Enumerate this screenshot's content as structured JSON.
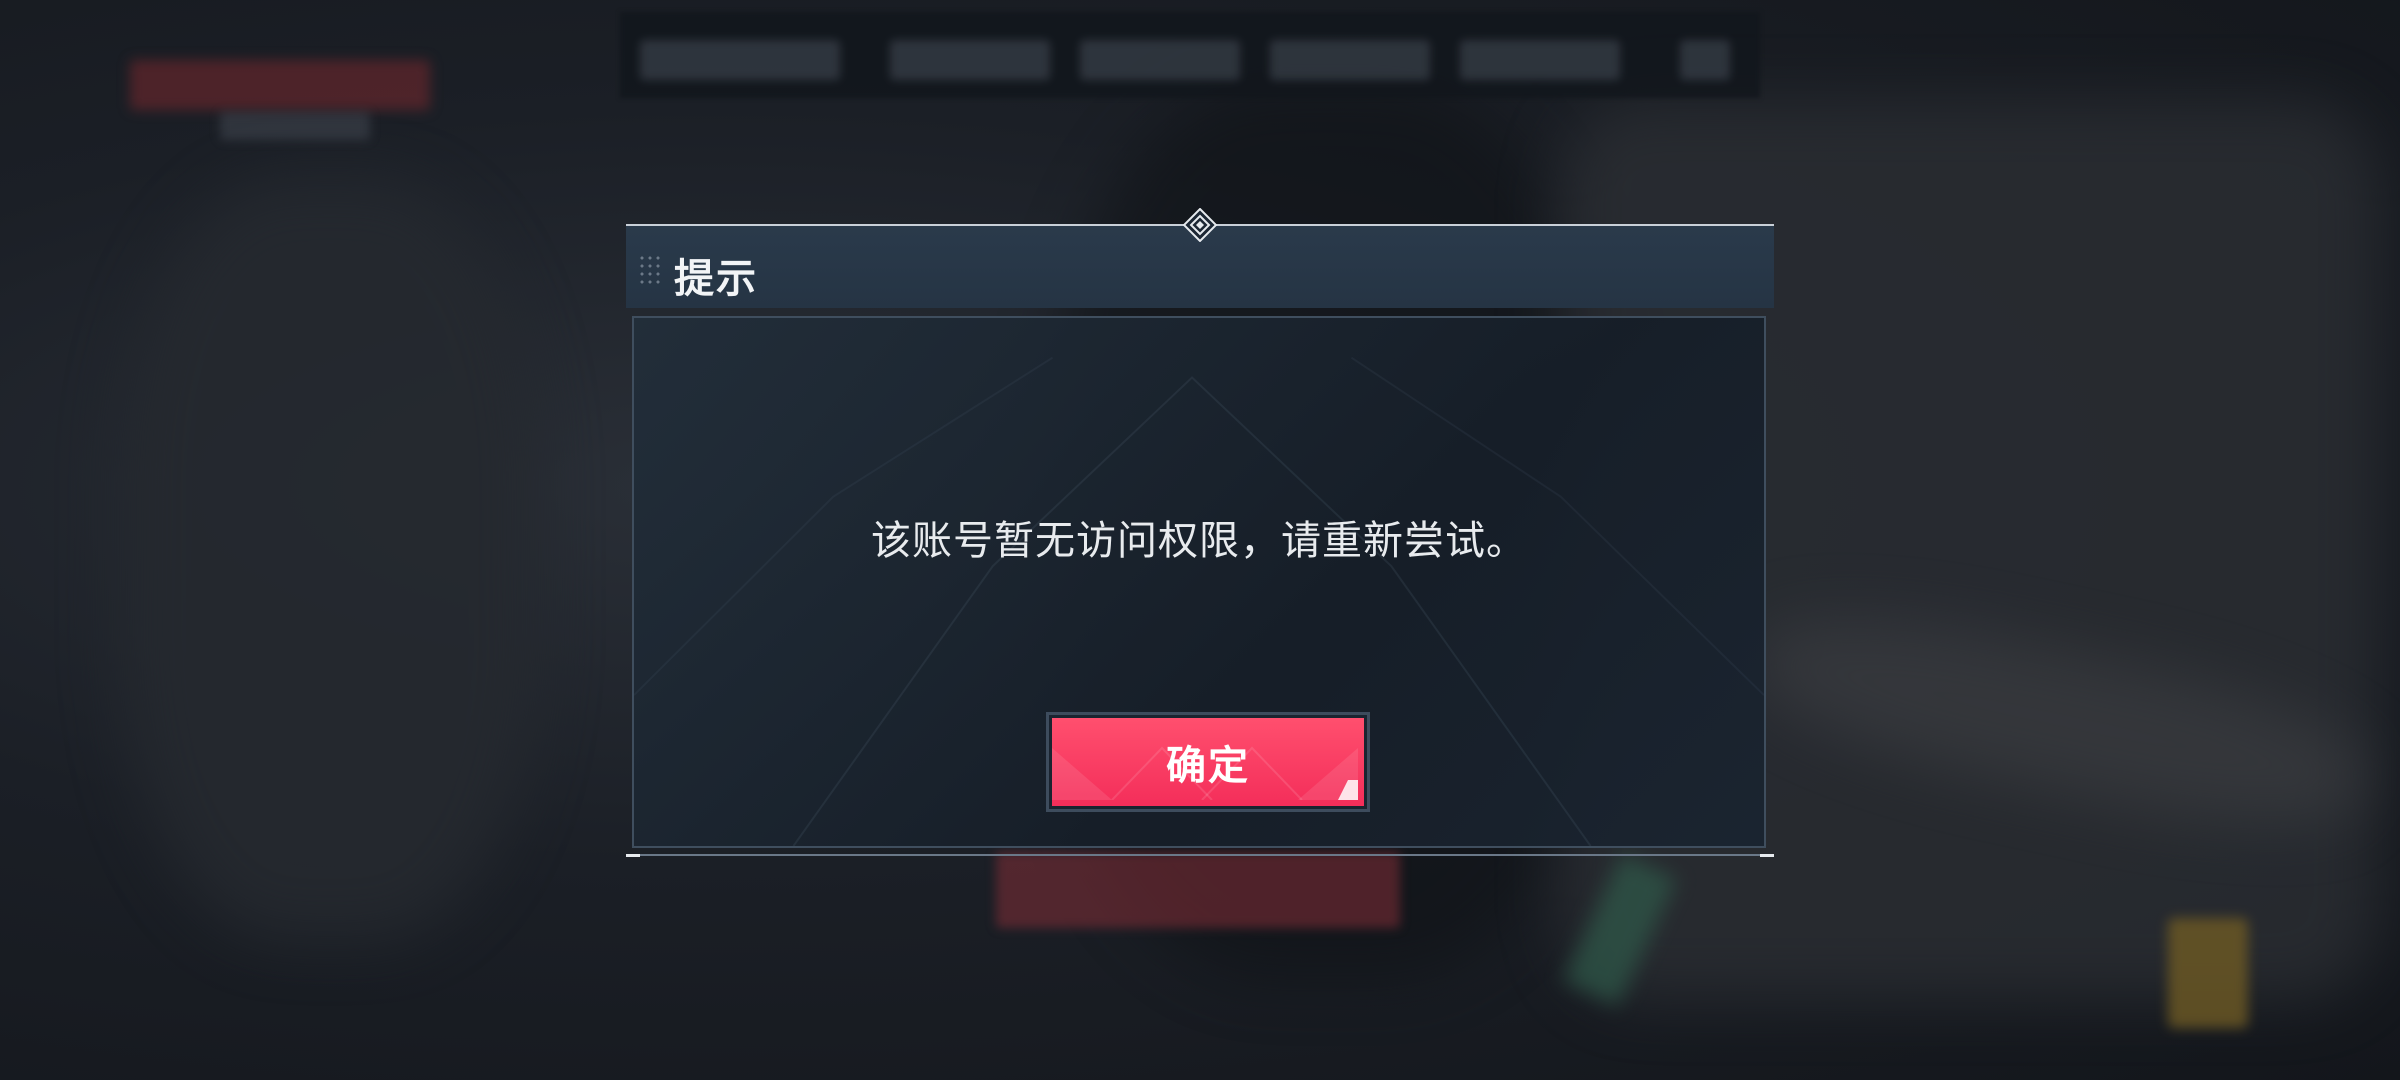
{
  "dialog": {
    "title": "提示",
    "message": "该账号暂无访问权限，请重新尝试。",
    "confirm_label": "确定"
  },
  "colors": {
    "accent": "#f42e5a",
    "title_bar": "#253444",
    "dialog_body": "#1b2633"
  },
  "icons": {
    "drag_handle": "grip-dots-icon",
    "top_ornament": "diamond-ornament-icon"
  }
}
